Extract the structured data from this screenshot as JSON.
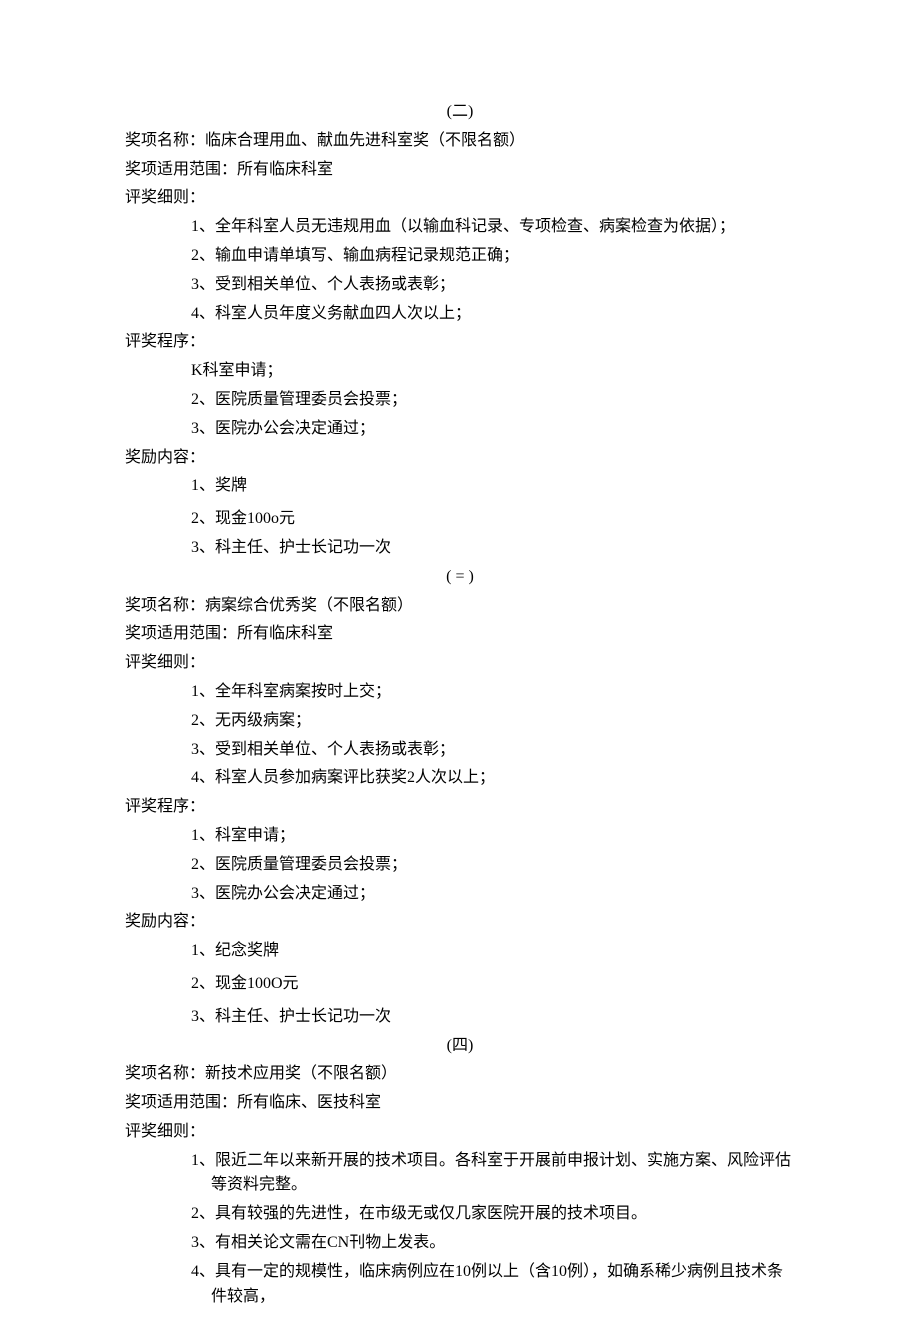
{
  "section2": {
    "number": "(二)",
    "name_label": "奖项名称：",
    "name_value": "临床合理用血、献血先进科室奖（不限名额）",
    "scope_label": "奖项适用范围：",
    "scope_value": "所有临床科室",
    "rules_label": "评奖细则：",
    "rules": [
      "1、全年科室人员无违规用血（以输血科记录、专项检查、病案检查为依据）；",
      "2、输血申请单填写、输血病程记录规范正确；",
      "3、受到相关单位、个人表扬或表彰；",
      "4、科室人员年度义务献血四人次以上；"
    ],
    "procedure_label": "评奖程序：",
    "procedure": [
      "K科室申请；",
      "2、医院质量管理委员会投票；",
      "3、医院办公会决定通过；"
    ],
    "reward_label": "奖励内容：",
    "rewards": [
      "1、奖牌",
      "2、现金100o元",
      "3、科主任、护士长记功一次"
    ]
  },
  "section3": {
    "number": "( = )",
    "name_label": "奖项名称：",
    "name_value": "病案综合优秀奖（不限名额）",
    "scope_label": "奖项适用范围：",
    "scope_value": "所有临床科室",
    "rules_label": "评奖细则：",
    "rules": [
      "1、全年科室病案按时上交；",
      "2、无丙级病案；",
      "3、受到相关单位、个人表扬或表彰；",
      "4、科室人员参加病案评比获奖2人次以上；"
    ],
    "procedure_label": "评奖程序：",
    "procedure": [
      "1、科室申请；",
      "2、医院质量管理委员会投票；",
      "3、医院办公会决定通过；"
    ],
    "reward_label": "奖励内容：",
    "rewards": [
      "1、纪念奖牌",
      "2、现金100O元",
      "3、科主任、护士长记功一次"
    ]
  },
  "section4": {
    "number": "(四)",
    "name_label": "奖项名称：",
    "name_value": "新技术应用奖（不限名额）",
    "scope_label": "奖项适用范围：",
    "scope_value": "所有临床、医技科室",
    "rules_label": "评奖细则：",
    "rules": [
      "1、限近二年以来新开展的技术项目。各科室于开展前申报计划、实施方案、风险评估等资料完整。",
      "2、具有较强的先进性，在市级无或仅几家医院开展的技术项目。",
      "3、有相关论文需在CN刊物上发表。",
      "4、具有一定的规模性，临床病例应在10例以上（含10例），如确系稀少病例且技术条件较高，"
    ]
  }
}
